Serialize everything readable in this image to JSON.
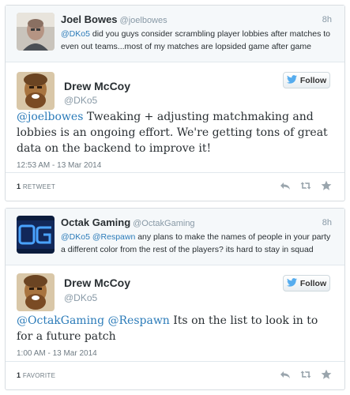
{
  "colors": {
    "link": "#2b7bb9",
    "twitter_blue": "#55acee",
    "muted": "#8899a6"
  },
  "tweets": [
    {
      "context": {
        "name": "Joel Bowes",
        "handle": "@joelbowes",
        "time": "8h",
        "mention": "@DKo5",
        "text": " did you guys consider scrambling player lobbies after matches to even out teams...most of my matches are lopsided game after game"
      },
      "main": {
        "name": "Drew McCoy",
        "handle": "@DKo5",
        "follow_label": "Follow",
        "mention": "@joelbowes",
        "text": " Tweaking + adjusting matchmaking and lobbies is an ongoing effort. We're getting tons of great data on the backend to improve it!",
        "timestamp": "12:53 AM - 13 Mar 2014",
        "stat_count": "1",
        "stat_label": "RETWEET"
      }
    },
    {
      "context": {
        "name": "Octak Gaming",
        "handle": "@OctakGaming",
        "time": "8h",
        "mention1": "@DKo5",
        "mention2": "@Respawn",
        "text": " any plans to make the names of people in your party a different color from the rest of the players? its hard to stay in squad"
      },
      "main": {
        "name": "Drew McCoy",
        "handle": "@DKo5",
        "follow_label": "Follow",
        "mention1": "@OctakGaming",
        "mention2": "@Respawn",
        "text": " Its on the list to look in to for a future patch",
        "timestamp": "1:00 AM - 13 Mar 2014",
        "stat_count": "1",
        "stat_label": "FAVORITE"
      }
    }
  ]
}
